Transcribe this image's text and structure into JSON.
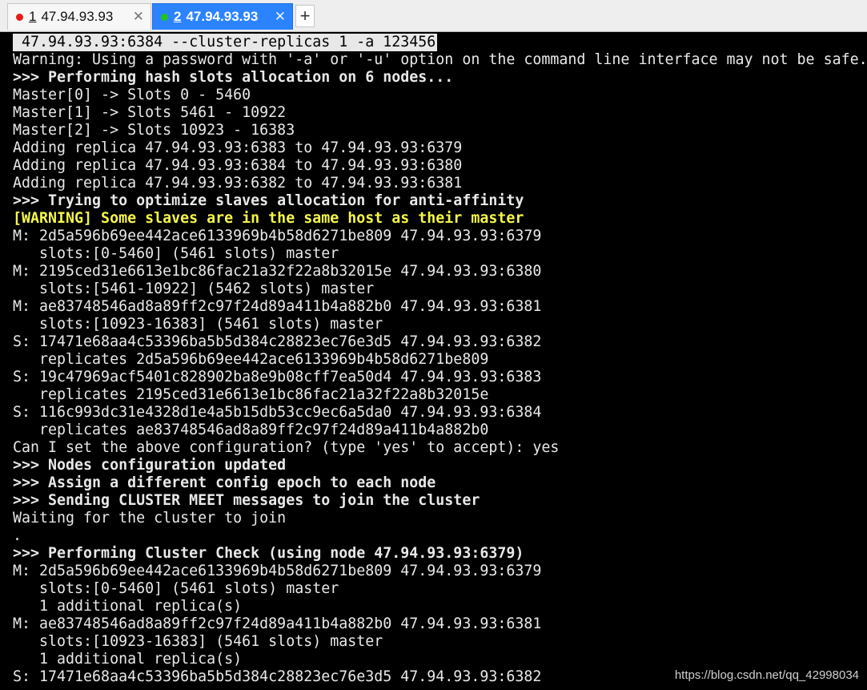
{
  "tabs": [
    {
      "num": "1",
      "label": "47.94.93.93",
      "close": "✕",
      "status_color": "#e81b1b"
    },
    {
      "num": "2",
      "label": "47.94.93.93",
      "close": "✕",
      "status_color": "#22c31f",
      "active": true
    }
  ],
  "add_tab": "+",
  "terminal": {
    "lines": [
      " 47.94.93.93:6384 --cluster-replicas 1 -a 123456",
      "Warning: Using a password with '-a' or '-u' option on the command line interface may not be safe.",
      ">>> Performing hash slots allocation on 6 nodes...",
      "Master[0] -> Slots 0 - 5460",
      "Master[1] -> Slots 5461 - 10922",
      "Master[2] -> Slots 10923 - 16383",
      "Adding replica 47.94.93.93:6383 to 47.94.93.93:6379",
      "Adding replica 47.94.93.93:6384 to 47.94.93.93:6380",
      "Adding replica 47.94.93.93:6382 to 47.94.93.93:6381",
      ">>> Trying to optimize slaves allocation for anti-affinity",
      "[WARNING] Some slaves are in the same host as their master",
      "M: 2d5a596b69ee442ace6133969b4b58d6271be809 47.94.93.93:6379",
      "   slots:[0-5460] (5461 slots) master",
      "M: 2195ced31e6613e1bc86fac21a32f22a8b32015e 47.94.93.93:6380",
      "   slots:[5461-10922] (5462 slots) master",
      "M: ae83748546ad8a89ff2c97f24d89a411b4a882b0 47.94.93.93:6381",
      "   slots:[10923-16383] (5461 slots) master",
      "S: 17471e68aa4c53396ba5b5d384c28823ec76e3d5 47.94.93.93:6382",
      "   replicates 2d5a596b69ee442ace6133969b4b58d6271be809",
      "S: 19c47969acf5401c828902ba8e9b08cff7ea50d4 47.94.93.93:6383",
      "   replicates 2195ced31e6613e1bc86fac21a32f22a8b32015e",
      "S: 116c993dc31e4328d1e4a5b15db53cc9ec6a5da0 47.94.93.93:6384",
      "   replicates ae83748546ad8a89ff2c97f24d89a411b4a882b0",
      "Can I set the above configuration? (type 'yes' to accept): yes",
      ">>> Nodes configuration updated",
      ">>> Assign a different config epoch to each node",
      ">>> Sending CLUSTER MEET messages to join the cluster",
      "Waiting for the cluster to join",
      ".",
      ">>> Performing Cluster Check (using node 47.94.93.93:6379)",
      "M: 2d5a596b69ee442ace6133969b4b58d6271be809 47.94.93.93:6379",
      "   slots:[0-5460] (5461 slots) master",
      "   1 additional replica(s)",
      "M: ae83748546ad8a89ff2c97f24d89a411b4a882b0 47.94.93.93:6381",
      "   slots:[10923-16383] (5461 slots) master",
      "   1 additional replica(s)",
      "S: 17471e68aa4c53396ba5b5d384c28823ec76e3d5 47.94.93.93:6382"
    ],
    "colors": {
      "text": "#e8e8e8",
      "warning": "#f6f64a",
      "background": "#000000"
    }
  },
  "watermark": "https://blog.csdn.net/qq_42998034"
}
